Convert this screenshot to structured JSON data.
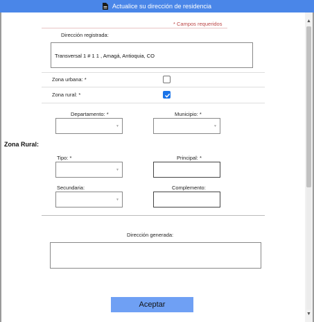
{
  "header": {
    "title": "Actualice su dirección de residencia",
    "icon": "document-icon"
  },
  "form": {
    "required_note": "* Campos requeridos",
    "registered_address": {
      "label": "Dirección registrada:",
      "value": "Transversal 1 # 1 1 , Amagá, Antioquia, CO"
    },
    "zona_urbana": {
      "label": "Zona urbana:",
      "required": "*",
      "checked": false
    },
    "zona_rural": {
      "label": "Zona rural:",
      "required": "*",
      "checked": true
    },
    "section_title": "Zona Rural:",
    "departamento": {
      "label": "Departamento:",
      "required": "*",
      "value": ""
    },
    "municipio": {
      "label": "Municipio:",
      "required": "*",
      "value": ""
    },
    "tipo": {
      "label": "Tipo:",
      "required": "*",
      "value": ""
    },
    "principal": {
      "label": "Principal:",
      "required": "*",
      "value": ""
    },
    "secundaria": {
      "label": "Secundaria:",
      "value": ""
    },
    "complemento": {
      "label": "Complemento:",
      "value": ""
    },
    "generated_address": {
      "label": "Dirección generada:",
      "value": ""
    },
    "submit_label": "Aceptar"
  },
  "colors": {
    "header_bg": "#4a86e8",
    "checkbox_checked": "#1a73e8",
    "button_bg": "#6fa0f4",
    "required_note": "#b44444"
  }
}
